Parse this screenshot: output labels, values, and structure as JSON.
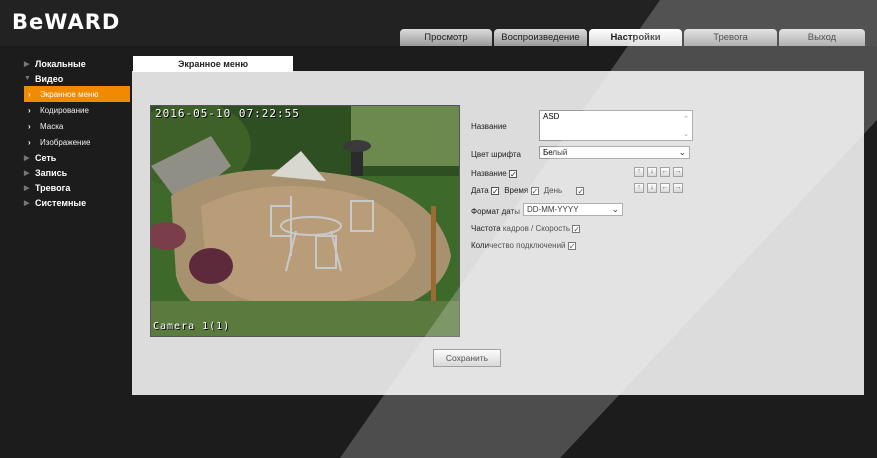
{
  "brand": {
    "logo_text": "BeWARD"
  },
  "tabs": [
    {
      "label": "Просмотр",
      "active": false
    },
    {
      "label": "Воспроизведение",
      "active": false
    },
    {
      "label": "Настройки",
      "active": true
    },
    {
      "label": "Тревога",
      "active": false
    },
    {
      "label": "Выход",
      "active": false
    }
  ],
  "sidebar": {
    "items": [
      {
        "label": "Локальные"
      },
      {
        "label": "Видео"
      },
      {
        "label": "Экранное меню"
      },
      {
        "label": "Кодирование"
      },
      {
        "label": "Маска"
      },
      {
        "label": "Изображение"
      },
      {
        "label": "Сеть"
      },
      {
        "label": "Запись"
      },
      {
        "label": "Тревога"
      },
      {
        "label": "Системные"
      }
    ]
  },
  "panel": {
    "tab_label": "Экранное меню"
  },
  "video": {
    "timestamp": "2016-05-10 07:22:55",
    "camera_label": "Camera 1(1)"
  },
  "form": {
    "name_label": "Название",
    "name_value": "ASD",
    "font_color_label": "Цвет шрифта",
    "font_color_value": "Белый",
    "name_checkbox_label": "Название",
    "date_checkbox_label": "Дата",
    "time_checkbox_label": "Время",
    "day_checkbox_label": "День",
    "date_format_label": "Формат даты",
    "date_format_value": "DD-MM-YYYY",
    "fps_label": "Частота кадров / Скорость",
    "connections_label": "Количество подключений",
    "save_label": "Сохранить",
    "checked_mark": "✓"
  },
  "colors": {
    "accent": "#f08a00",
    "background": "#1c1c1c",
    "panel": "#dcdcdc"
  }
}
